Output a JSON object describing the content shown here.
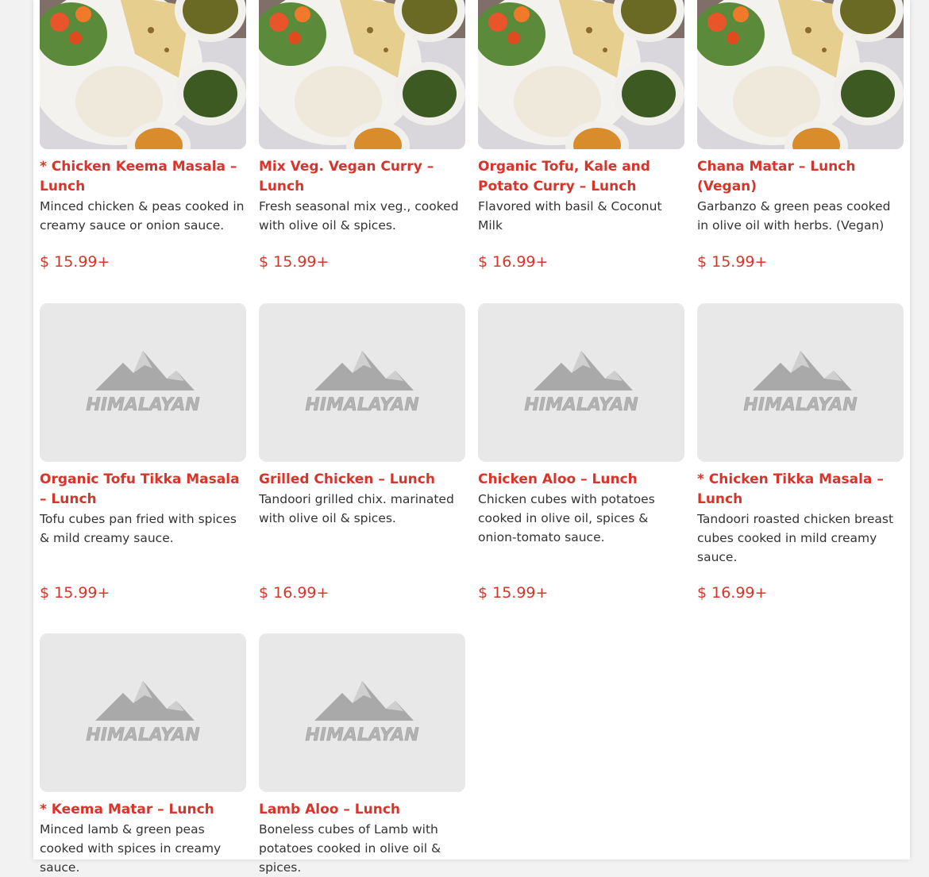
{
  "colors": {
    "accent": "#d8342a",
    "text": "#333333",
    "placeholder_bg": "#e8e8e8"
  },
  "placeholder_logo_text": "HIMALAYAN",
  "items": [
    {
      "title": "* Chicken Keema Masala – Lunch",
      "desc": "Minced chicken & peas cooked in creamy sauce or onion sauce.",
      "price": "$ 15.99+",
      "image": "photo"
    },
    {
      "title": "Mix Veg. Vegan Curry – Lunch",
      "desc": "Fresh seasonal mix veg., cooked with olive oil & spices.",
      "price": "$ 15.99+",
      "image": "photo"
    },
    {
      "title": "Organic Tofu, Kale and Potato Curry – Lunch",
      "desc": "Flavored with basil & Coconut Milk",
      "price": "$ 16.99+",
      "image": "photo"
    },
    {
      "title": "Chana Matar – Lunch (Vegan)",
      "desc": "Garbanzo & green peas cooked in olive oil with herbs. (Vegan)",
      "price": "$ 15.99+",
      "image": "photo"
    },
    {
      "title": "Organic Tofu Tikka Masala – Lunch",
      "desc": "Tofu cubes pan fried with spices & mild creamy sauce.",
      "price": "$ 15.99+",
      "image": "placeholder"
    },
    {
      "title": "Grilled Chicken – Lunch",
      "desc": "Tandoori grilled chix. marinated with olive oil & spices.",
      "price": "$ 16.99+",
      "image": "placeholder"
    },
    {
      "title": "Chicken Aloo – Lunch",
      "desc": "Chicken cubes with potatoes cooked in olive oil, spices & onion-tomato sauce.",
      "price": "$ 15.99+",
      "image": "placeholder"
    },
    {
      "title": "* Chicken Tikka Masala – Lunch",
      "desc": "Tandoori roasted chicken breast cubes cooked in mild creamy sauce.",
      "price": "$ 16.99+",
      "image": "placeholder"
    },
    {
      "title": "* Keema Matar – Lunch",
      "desc": "Minced lamb & green peas cooked with spices in creamy sauce.",
      "price": "",
      "image": "placeholder"
    },
    {
      "title": "Lamb Aloo – Lunch",
      "desc": "Boneless cubes of Lamb with potatoes cooked in olive oil & spices.",
      "price": "",
      "image": "placeholder"
    }
  ]
}
